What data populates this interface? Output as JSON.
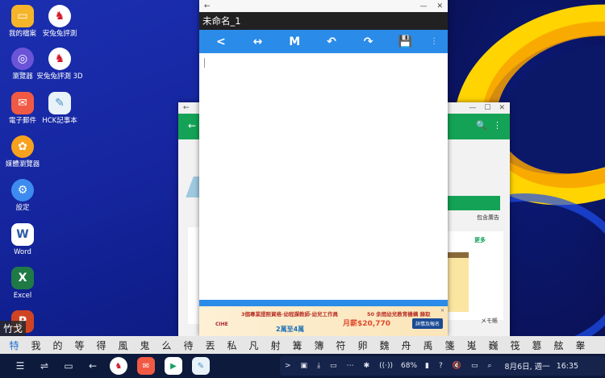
{
  "desktop": {
    "icons": [
      {
        "label": "我的檔案",
        "glyph": "▭",
        "icon": "folder-icon"
      },
      {
        "label": "安兔兔評測",
        "glyph": "♞",
        "icon": "antutu-icon"
      },
      {
        "label": "瀏覽器",
        "glyph": "◎",
        "icon": "internet-browser-icon"
      },
      {
        "label": "安兔兔評測 3D",
        "glyph": "♞",
        "icon": "antutu-3d-icon"
      },
      {
        "label": "電子郵件",
        "glyph": "✉",
        "icon": "email-icon"
      },
      {
        "label": "HCK記事本",
        "glyph": "✎",
        "icon": "notebook-icon"
      },
      {
        "label": "媒體瀏覽器",
        "glyph": "✿",
        "icon": "media-browser-icon"
      },
      {
        "label": "設定",
        "glyph": "⚙",
        "icon": "settings-icon"
      },
      {
        "label": "Word",
        "glyph": "W",
        "icon": "word-icon"
      },
      {
        "label": "Excel",
        "glyph": "X",
        "icon": "excel-icon"
      },
      {
        "label": "",
        "glyph": "P",
        "icon": "powerpoint-icon"
      }
    ]
  },
  "back_window": {
    "titlebar": {
      "back": "←",
      "minimize": "—",
      "maximize": "☐",
      "close": "✕"
    },
    "appbar": {
      "back": "←",
      "search": "🔍",
      "menu": "⋮"
    },
    "ad_label": "包含廣告",
    "more_label": "更多",
    "memo_label": "メモ帳"
  },
  "front_window": {
    "titlebar": {
      "back": "←",
      "minimize": "—",
      "close": "✕"
    },
    "doc_title": "未命名_1",
    "toolbar": {
      "back": "<",
      "resize": "↔",
      "mode": "M",
      "undo": "↶",
      "redo": "↷",
      "save": "💾",
      "overflow": "⋮"
    },
    "ad": {
      "line1": "3個專業證照資格·幼程課教師·幼兒工作員",
      "line2": "50 余間幼兒教育機構 錄取",
      "salary": "月薪$20,770",
      "logo": "CIHE",
      "num": "2萬至4萬",
      "button": "詳情及報名",
      "close": "✕"
    }
  },
  "ime": {
    "preedit": "竹戈",
    "candidates": [
      "特",
      "我",
      "的",
      "等",
      "得",
      "風",
      "鬼",
      "么",
      "待",
      "丟",
      "私",
      "凡",
      "射",
      "篝",
      "簿",
      "符",
      "卵",
      "魏",
      "舟",
      "禹",
      "箋",
      "嵬",
      "巍",
      "筏",
      "篡",
      "舷",
      "睾"
    ]
  },
  "taskbar": {
    "left": [
      "☰",
      "⇌",
      "▭",
      "←"
    ],
    "tray": {
      "chevron": ">",
      "icons": [
        "▣",
        "⤓",
        "▭",
        "⋯",
        "✱",
        "((·))",
        "▮"
      ],
      "battery": "68%",
      "battery_icon": "▮",
      "help": "?",
      "mute": "🔇",
      "screen": "▭",
      "search": "⌕",
      "date": "8月6日, 週一",
      "time": "16:35"
    }
  }
}
